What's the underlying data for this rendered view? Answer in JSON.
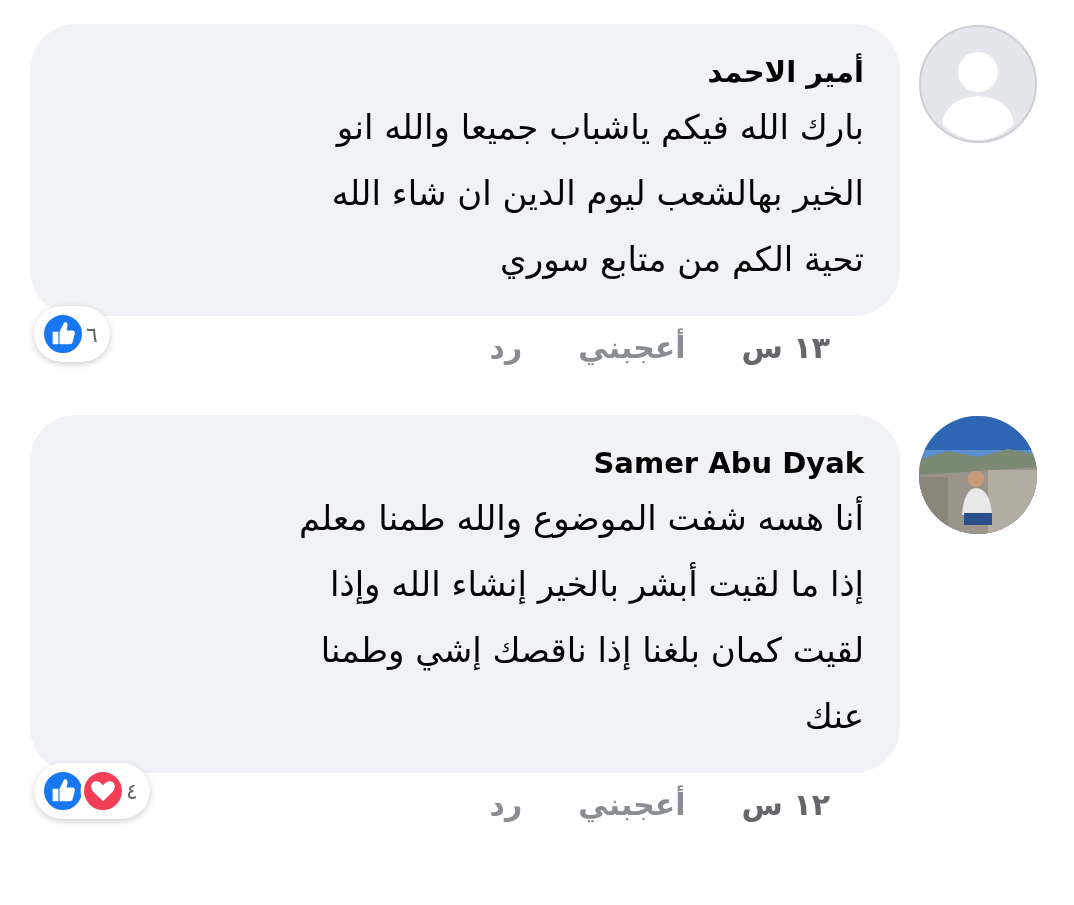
{
  "comments": [
    {
      "author": "أمير الاحمد",
      "avatar": {
        "kind": "default"
      },
      "text": "بارك الله فيكم ياشباب جميعا والله انو\nالخير بهالشعب ليوم الدين ان شاء الله\nتحية الكم من متابع سوري",
      "reactions": [
        {
          "kind": "like"
        }
      ],
      "reaction_count": "٦",
      "time": "١٣ س",
      "like_label": "أعجبني",
      "reply_label": "رد"
    },
    {
      "author": "Samer Abu Dyak",
      "text": "أنا هسه شفت  الموضوع والله  طمنا معلم\nإذا ما لقيت  أبشر بالخير إنشاء الله وإذا\nلقيت كمان بلغنا إذا ناقصك  إشي وطمنا\nعنك",
      "reactions": [
        {
          "kind": "love"
        },
        {
          "kind": "like"
        }
      ],
      "reaction_count": "٤",
      "time": "١٢ س",
      "like_label": "أعجبني",
      "reply_label": "رد"
    }
  ]
}
